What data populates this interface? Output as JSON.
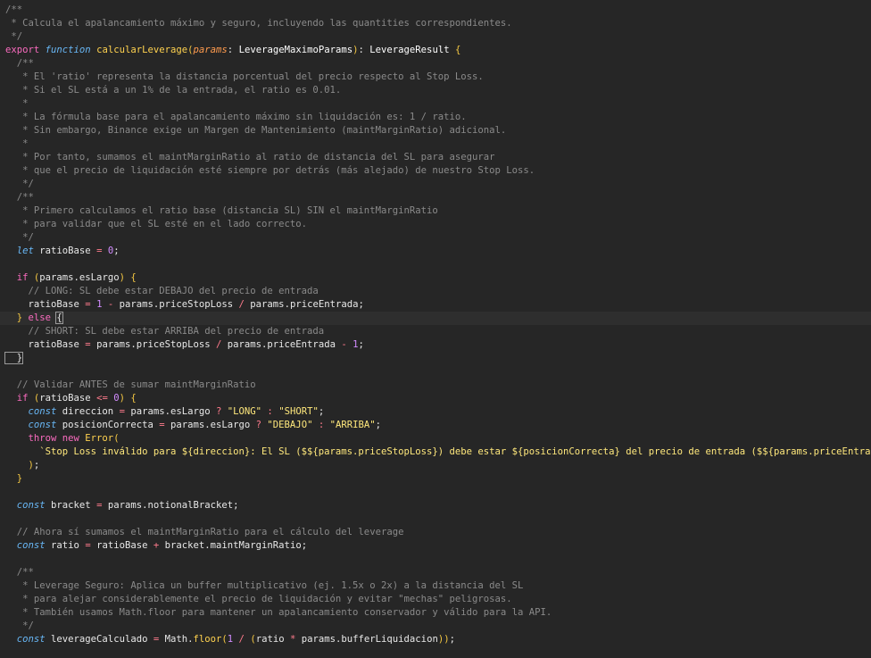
{
  "lines": [
    [
      [
        "c",
        "/**"
      ]
    ],
    [
      [
        "c",
        " * Calcula el apalancamiento máximo y seguro, incluyendo las quantities correspondientes."
      ]
    ],
    [
      [
        "c",
        " */"
      ]
    ],
    [
      [
        "k",
        "export "
      ],
      [
        "kf",
        "function "
      ],
      [
        "fn",
        "calcularLeverage"
      ],
      [
        "br",
        "("
      ],
      [
        "p",
        "params"
      ],
      [
        "pu",
        ": "
      ],
      [
        "t",
        "LeverageMaximoParams"
      ],
      [
        "br",
        ")"
      ],
      [
        "pu",
        ": "
      ],
      [
        "t",
        "LeverageResult "
      ],
      [
        "br",
        "{"
      ]
    ],
    [
      [
        "c",
        "  /**"
      ]
    ],
    [
      [
        "c",
        "   * El 'ratio' representa la distancia porcentual del precio respecto al Stop Loss."
      ]
    ],
    [
      [
        "c",
        "   * Si el SL está a un 1% de la entrada, el ratio es 0.01."
      ]
    ],
    [
      [
        "c",
        "   *"
      ]
    ],
    [
      [
        "c",
        "   * La fórmula base para el apalancamiento máximo sin liquidación es: 1 / ratio."
      ]
    ],
    [
      [
        "c",
        "   * Sin embargo, Binance exige un Margen de Mantenimiento (maintMarginRatio) adicional."
      ]
    ],
    [
      [
        "c",
        "   *"
      ]
    ],
    [
      [
        "c",
        "   * Por tanto, sumamos el maintMarginRatio al ratio de distancia del SL para asegurar"
      ]
    ],
    [
      [
        "c",
        "   * que el precio de liquidación esté siempre por detrás (más alejado) de nuestro Stop Loss."
      ]
    ],
    [
      [
        "c",
        "   */"
      ]
    ],
    [
      [
        "c",
        "  /**"
      ]
    ],
    [
      [
        "c",
        "   * Primero calculamos el ratio base (distancia SL) SIN el maintMarginRatio"
      ]
    ],
    [
      [
        "c",
        "   * para validar que el SL esté en el lado correcto."
      ]
    ],
    [
      [
        "c",
        "   */"
      ]
    ],
    [
      [
        "kf",
        "  let "
      ],
      [
        "pu",
        "ratioBase "
      ],
      [
        "o",
        "= "
      ],
      [
        "n",
        "0"
      ],
      [
        "pu",
        ";"
      ]
    ],
    [
      [
        "pu",
        ""
      ]
    ],
    [
      [
        "k",
        "  if "
      ],
      [
        "br",
        "("
      ],
      [
        "pu",
        "params.esLargo"
      ],
      [
        "br",
        ")"
      ],
      [
        "pu",
        " "
      ],
      [
        "br",
        "{"
      ]
    ],
    [
      [
        "c",
        "    // LONG: SL debe estar DEBAJO del precio de entrada"
      ]
    ],
    [
      [
        "pu",
        "    ratioBase "
      ],
      [
        "o",
        "= "
      ],
      [
        "n",
        "1 "
      ],
      [
        "o",
        "- "
      ],
      [
        "pu",
        "params.priceStopLoss "
      ],
      [
        "o",
        "/ "
      ],
      [
        "pu",
        "params.priceEntrada;"
      ]
    ],
    [
      [
        "br",
        "  }"
      ],
      [
        "k",
        " else "
      ],
      [
        "bm",
        "{"
      ]
    ],
    [
      [
        "c",
        "    // SHORT: SL debe estar ARRIBA del precio de entrada"
      ]
    ],
    [
      [
        "pu",
        "    ratioBase "
      ],
      [
        "o",
        "= "
      ],
      [
        "pu",
        "params.priceStopLoss "
      ],
      [
        "o",
        "/ "
      ],
      [
        "pu",
        "params.priceEntrada "
      ],
      [
        "o",
        "- "
      ],
      [
        "n",
        "1"
      ],
      [
        "pu",
        ";"
      ]
    ],
    [
      [
        "bm",
        "  }"
      ]
    ],
    [
      [
        "pu",
        ""
      ]
    ],
    [
      [
        "c",
        "  // Validar ANTES de sumar maintMarginRatio"
      ]
    ],
    [
      [
        "k",
        "  if "
      ],
      [
        "br",
        "("
      ],
      [
        "pu",
        "ratioBase "
      ],
      [
        "o",
        "<= "
      ],
      [
        "n",
        "0"
      ],
      [
        "br",
        ")"
      ],
      [
        "pu",
        " "
      ],
      [
        "br",
        "{"
      ]
    ],
    [
      [
        "kf",
        "    const "
      ],
      [
        "pu",
        "direccion "
      ],
      [
        "o",
        "= "
      ],
      [
        "pu",
        "params.esLargo "
      ],
      [
        "o",
        "? "
      ],
      [
        "s",
        "\"LONG\" "
      ],
      [
        "o",
        ": "
      ],
      [
        "s",
        "\"SHORT\""
      ],
      [
        "pu",
        ";"
      ]
    ],
    [
      [
        "kf",
        "    const "
      ],
      [
        "pu",
        "posicionCorrecta "
      ],
      [
        "o",
        "= "
      ],
      [
        "pu",
        "params.esLargo "
      ],
      [
        "o",
        "? "
      ],
      [
        "s",
        "\"DEBAJO\" "
      ],
      [
        "o",
        ": "
      ],
      [
        "s",
        "\"ARRIBA\""
      ],
      [
        "pu",
        ";"
      ]
    ],
    [
      [
        "k",
        "    throw "
      ],
      [
        "k",
        "new "
      ],
      [
        "fn",
        "Error"
      ],
      [
        "br",
        "("
      ]
    ],
    [
      [
        "s",
        "      `Stop Loss inválido para ${direccion}: El SL ($${params.priceStopLoss}) debe estar ${posicionCorrecta} del precio de entrada ($${params.priceEntrada})`"
      ],
      [
        "pu",
        ","
      ]
    ],
    [
      [
        "br",
        "    )"
      ],
      [
        "pu",
        ";"
      ]
    ],
    [
      [
        "br",
        "  }"
      ]
    ],
    [
      [
        "pu",
        ""
      ]
    ],
    [
      [
        "kf",
        "  const "
      ],
      [
        "pu",
        "bracket "
      ],
      [
        "o",
        "= "
      ],
      [
        "pu",
        "params.notionalBracket;"
      ]
    ],
    [
      [
        "pu",
        ""
      ]
    ],
    [
      [
        "c",
        "  // Ahora sí sumamos el maintMarginRatio para el cálculo del leverage"
      ]
    ],
    [
      [
        "kf",
        "  const "
      ],
      [
        "pu",
        "ratio "
      ],
      [
        "o",
        "= "
      ],
      [
        "pu",
        "ratioBase "
      ],
      [
        "o",
        "+ "
      ],
      [
        "pu",
        "bracket.maintMarginRatio;"
      ]
    ],
    [
      [
        "pu",
        ""
      ]
    ],
    [
      [
        "c",
        "  /**"
      ]
    ],
    [
      [
        "c",
        "   * Leverage Seguro: Aplica un buffer multiplicativo (ej. 1.5x o 2x) a la distancia del SL"
      ]
    ],
    [
      [
        "c",
        "   * para alejar considerablemente el precio de liquidación y evitar \"mechas\" peligrosas."
      ]
    ],
    [
      [
        "c",
        "   * También usamos Math.floor para mantener un apalancamiento conservador y válido para la API."
      ]
    ],
    [
      [
        "c",
        "   */"
      ]
    ],
    [
      [
        "kf",
        "  const "
      ],
      [
        "pu",
        "leverageCalculado "
      ],
      [
        "o",
        "= "
      ],
      [
        "pu",
        "Math."
      ],
      [
        "fn",
        "floor"
      ],
      [
        "br",
        "("
      ],
      [
        "n",
        "1 "
      ],
      [
        "o",
        "/ "
      ],
      [
        "br",
        "("
      ],
      [
        "pu",
        "ratio "
      ],
      [
        "o",
        "* "
      ],
      [
        "pu",
        "params.bufferLiquidacion"
      ],
      [
        "br",
        "))"
      ],
      [
        "pu",
        ";"
      ]
    ]
  ]
}
